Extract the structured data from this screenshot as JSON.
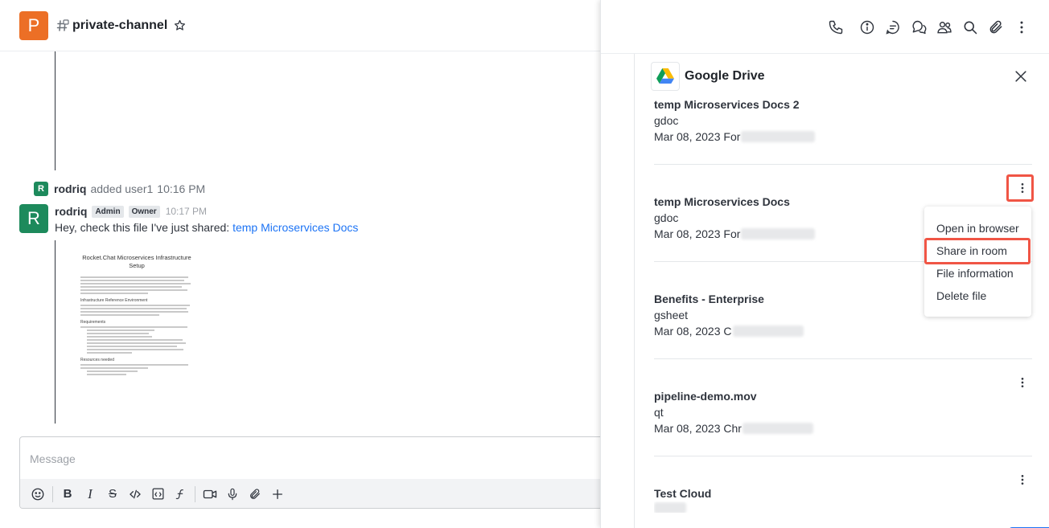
{
  "room": {
    "avatar_letter": "P",
    "name": "private-channel"
  },
  "messages": {
    "system": {
      "avatar_letter": "R",
      "user": "rodriq",
      "text": "added user1",
      "time": "10:16 PM"
    },
    "main": {
      "avatar_letter": "R",
      "user": "rodriq",
      "badges": [
        "Admin",
        "Owner"
      ],
      "time": "10:17 PM",
      "text": "Hey, check this file I've just shared:",
      "link": "temp Microservices Docs"
    },
    "preview": {
      "title": "Rocket.Chat Microservices Infrastructure Setup",
      "sections": [
        "Infrastructure Reference Environment",
        "Requirements",
        "Resources needed"
      ]
    }
  },
  "composer": {
    "placeholder": "Message"
  },
  "panel": {
    "app_title": "Google Drive",
    "files": [
      {
        "name": "temp Microservices Docs 2",
        "type": "gdoc",
        "meta": "Mar 08, 2023 For",
        "show_menu": false
      },
      {
        "name": "temp Microservices Docs",
        "type": "gdoc",
        "meta": "Mar 08, 2023 For",
        "show_menu": true
      },
      {
        "name": "Benefits - Enterprise",
        "type": "gsheet",
        "meta": "Mar 08, 2023 C",
        "show_menu": false
      },
      {
        "name": "pipeline-demo.mov",
        "type": "qt",
        "meta": "Mar 08, 2023 Chr",
        "show_menu": true
      },
      {
        "name": "Test Cloud",
        "type": "",
        "meta": "",
        "show_menu": true
      }
    ],
    "menu": [
      "Open in browser",
      "Share in room",
      "File information",
      "Delete file"
    ]
  },
  "colors": {
    "room_avatar": "#ec6f26",
    "user_avatar": "#1d8a5c",
    "link": "#1d74f5",
    "highlight": "#f05545"
  }
}
